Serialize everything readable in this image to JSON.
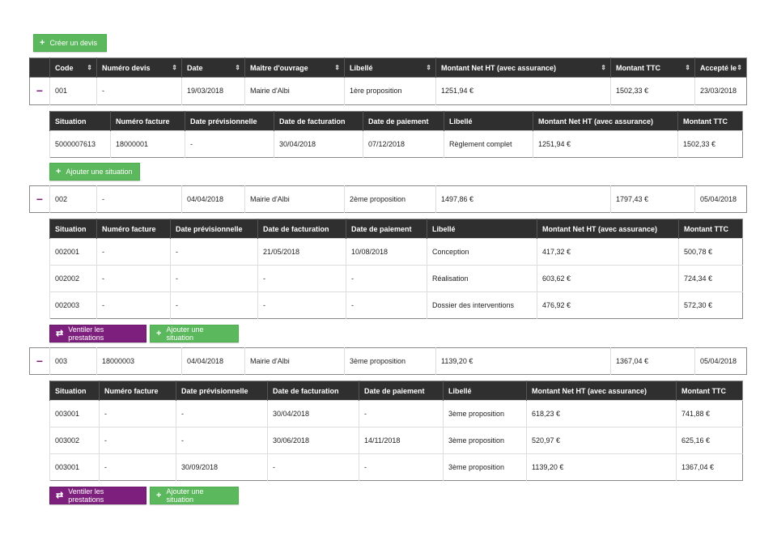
{
  "create_button": {
    "label": "Créer un devis",
    "icon": "plus-icon"
  },
  "colors": {
    "green": "#5cb85c",
    "purple": "#7d1f7d",
    "header": "#2f2f2f"
  },
  "main_headers": [
    "Code",
    "Numéro devis",
    "Date",
    "Maître d'ouvrage",
    "Libellé",
    "Montant Net HT (avec assurance)",
    "Montant TTC",
    "Accepté le"
  ],
  "sub_headers": [
    "Situation",
    "Numéro facture",
    "Date prévisionnelle",
    "Date de facturation",
    "Date de paiement",
    "Libellé",
    "Montant Net HT (avec assurance)",
    "Montant TTC"
  ],
  "toggle_symbol": "−",
  "buttons": {
    "add_situation": "Ajouter une situation",
    "ventiler": "Ventiler les prestations",
    "ventiler_icon": "⇄",
    "plus": "+"
  },
  "devis": [
    {
      "row": [
        "001",
        "-",
        "19/03/2018",
        "Mairie d'Albi",
        "1ère proposition",
        "1251,94 €",
        "1502,33 €",
        "23/03/2018"
      ],
      "situations": [
        [
          "5000007613",
          "18000001",
          "-",
          "30/04/2018",
          "07/12/2018",
          "Règlement complet",
          "1251,94 €",
          "1502,33 €"
        ]
      ],
      "ventiler": false
    },
    {
      "row": [
        "002",
        "-",
        "04/04/2018",
        "Mairie d'Albi",
        "2ème proposition",
        "1497,86 €",
        "1797,43 €",
        "05/04/2018"
      ],
      "situations": [
        [
          "002001",
          "-",
          "-",
          "21/05/2018",
          "10/08/2018",
          "Conception",
          "417,32 €",
          "500,78 €"
        ],
        [
          "002002",
          "-",
          "-",
          "-",
          "-",
          "Réalisation",
          "603,62 €",
          "724,34 €"
        ],
        [
          "002003",
          "-",
          "-",
          "-",
          "-",
          "Dossier des interventions",
          "476,92 €",
          "572,30 €"
        ]
      ],
      "ventiler": true
    },
    {
      "row": [
        "003",
        "18000003",
        "04/04/2018",
        "Mairie d'Albi",
        "3ème proposition",
        "1139,20 €",
        "1367,04 €",
        "05/04/2018"
      ],
      "situations": [
        [
          "003001",
          "-",
          "-",
          "30/04/2018",
          "-",
          "3ème proposition",
          "618,23 €",
          "741,88 €"
        ],
        [
          "003002",
          "-",
          "-",
          "30/06/2018",
          "14/11/2018",
          "3ème proposition",
          "520,97 €",
          "625,16 €"
        ],
        [
          "003001",
          "-",
          "30/09/2018",
          "-",
          "-",
          "3ème proposition",
          "1139,20 €",
          "1367,04 €"
        ]
      ],
      "ventiler": true
    }
  ]
}
